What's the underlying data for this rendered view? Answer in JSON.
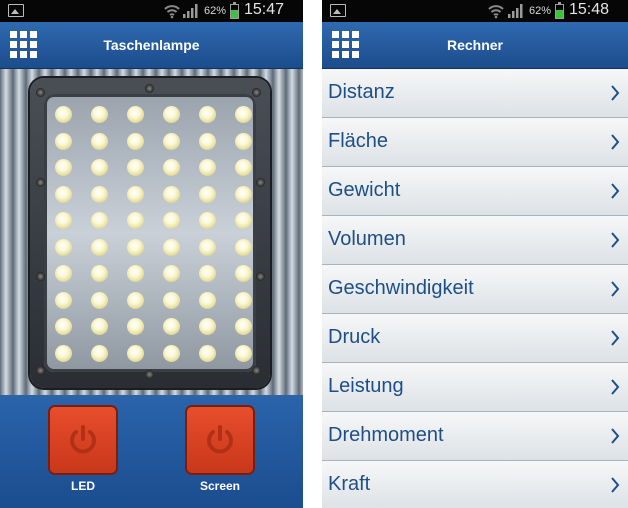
{
  "left": {
    "status": {
      "battery": "62%",
      "time": "15:47"
    },
    "title": "Taschenlampe",
    "buttons": {
      "led": "LED",
      "screen": "Screen"
    }
  },
  "right": {
    "status": {
      "battery": "62%",
      "time": "15:48"
    },
    "title": "Rechner",
    "items": [
      {
        "label": "Distanz"
      },
      {
        "label": "Fläche"
      },
      {
        "label": "Gewicht"
      },
      {
        "label": "Volumen"
      },
      {
        "label": "Geschwindigkeit"
      },
      {
        "label": "Druck"
      },
      {
        "label": "Leistung"
      },
      {
        "label": "Drehmoment"
      },
      {
        "label": "Kraft"
      }
    ]
  },
  "colors": {
    "accent": "#1c4c8c",
    "power_button": "#d9401f",
    "list_text": "#1d4f86",
    "battery": "#3ec23e"
  },
  "icons": [
    "image-icon",
    "wifi-icon",
    "signal-icon",
    "battery-icon",
    "grid-menu-icon",
    "power-icon",
    "chevron-right-icon"
  ]
}
